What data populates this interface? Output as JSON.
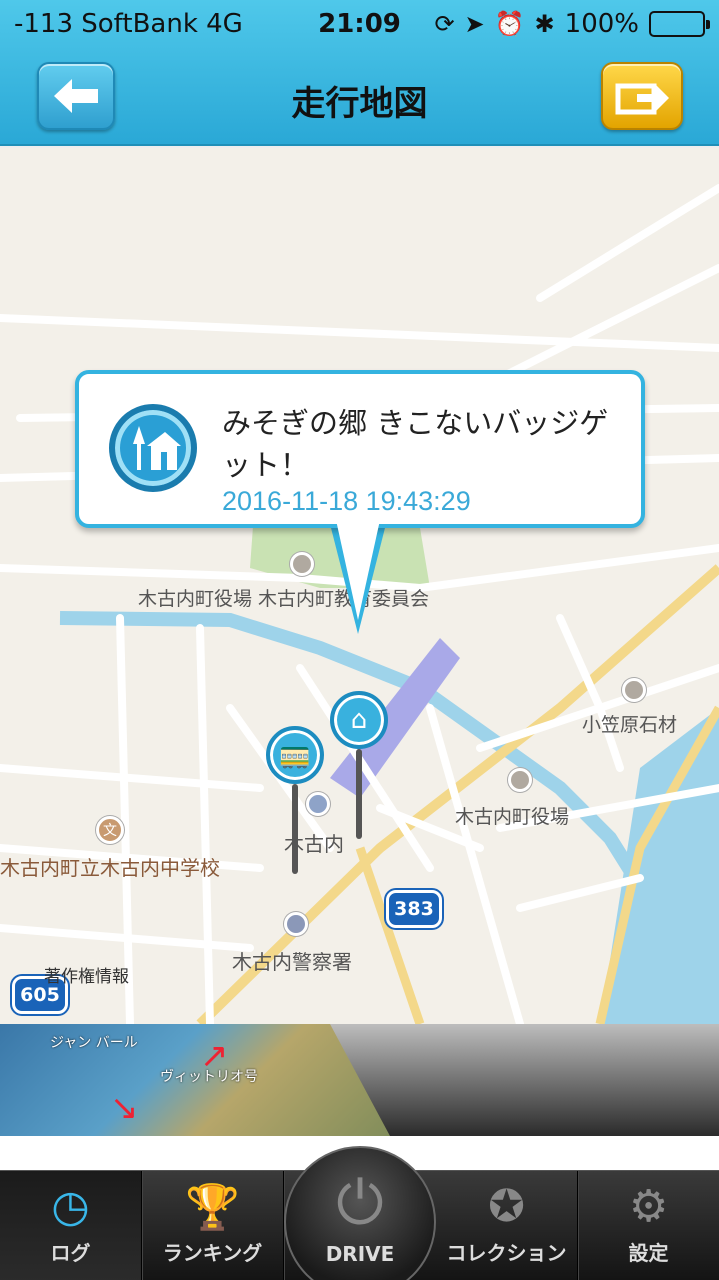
{
  "status": {
    "carrier": "-113 SoftBank  4G",
    "time": "21:09",
    "battery": "100%"
  },
  "nav": {
    "title": "走行地図",
    "back_icon": "arrow-left-icon",
    "share_icon": "share-arrow-icon"
  },
  "callout": {
    "message": "みそぎの郷 きこないバッジゲット！",
    "date": "2016-11-18 19:43:29"
  },
  "map": {
    "labels": {
      "town_office_edu": "木古内町役場 木古内町教育委員会",
      "ogasawara": "小笠原石材",
      "town_office": "木古内町役場",
      "station": "木古内",
      "school": "木古内町立木古内中学校",
      "police": "木古内警察署",
      "copyright": "著作権情報"
    },
    "routes": {
      "r383": "383",
      "r605": "605"
    }
  },
  "banner": {
    "label1": "ジャン バール",
    "label2": "ヴィットリオ号"
  },
  "tabs": [
    {
      "label": "ログ",
      "icon": "clock-icon"
    },
    {
      "label": "ランキング",
      "icon": "trophy-icon"
    },
    {
      "label": "DRIVE",
      "icon": "power-icon"
    },
    {
      "label": "コレクション",
      "icon": "star-icon"
    },
    {
      "label": "設定",
      "icon": "gear-icon"
    }
  ],
  "colors": {
    "accent": "#34b3e0",
    "share": "#f2c000"
  }
}
